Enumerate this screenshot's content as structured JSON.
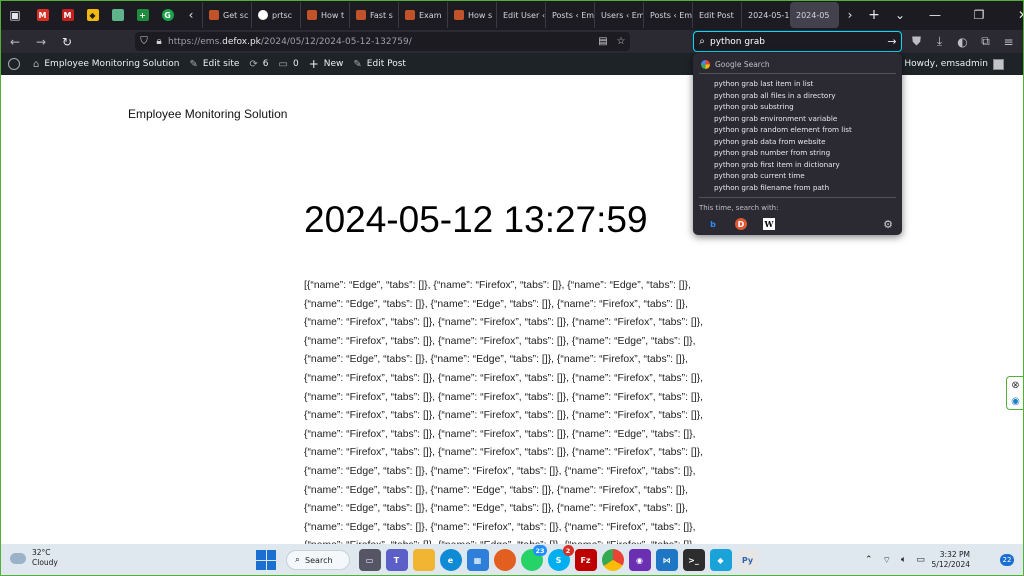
{
  "browser": {
    "tabs": [
      {
        "label": "Get sc",
        "favicon": "wp"
      },
      {
        "label": "prtsc",
        "favicon": "github"
      },
      {
        "label": "How t",
        "favicon": "wp"
      },
      {
        "label": "Fast s",
        "favicon": "wp"
      },
      {
        "label": "Exam",
        "favicon": "wp"
      },
      {
        "label": "How s",
        "favicon": "wp"
      },
      {
        "label": "Edit User ‹",
        "favicon": "none"
      },
      {
        "label": "Posts ‹ Em",
        "favicon": "none"
      },
      {
        "label": "Users ‹ Em",
        "favicon": "none"
      },
      {
        "label": "Posts ‹ Em",
        "favicon": "none"
      },
      {
        "label": "Edit Post",
        "favicon": "none"
      },
      {
        "label": "2024-05-1",
        "favicon": "none"
      },
      {
        "label": "2024-05",
        "favicon": "none",
        "active": true
      }
    ],
    "url_prefix": "https://ems.",
    "url_domain": "defox.pk",
    "url_path": "/2024/05/12/2024-05-12-132759/",
    "search_value": "python grab"
  },
  "search_dropdown": {
    "heading": "Google Search",
    "suggestions": [
      "python grab last item in list",
      "python grab all files in a directory",
      "python grab substring",
      "python grab environment variable",
      "python grab random element from list",
      "python grab data from website",
      "python grab number from string",
      "python grab first item in dictionary",
      "python grab current time",
      "python grab filename from path"
    ],
    "footer_label": "This time, search with:"
  },
  "adminbar": {
    "site_name": "Employee Monitoring Solution",
    "edit_site": "Edit site",
    "updates_count": "6",
    "comments_count": "0",
    "new_label": "New",
    "edit_post": "Edit Post",
    "howdy": "Howdy, emsadmin"
  },
  "page": {
    "site_title": "Employee Monitoring Solution",
    "post_title": "2024-05-12 13:27:59",
    "content": "[{“name”: “Edge”, “tabs”: []}, {“name”: “Firefox”, “tabs”: []}, {“name”: “Edge”, “tabs”: []}, {“name”: “Edge”, “tabs”: []}, {“name”: “Edge”, “tabs”: []}, {“name”: “Firefox”, “tabs”: []}, {“name”: “Firefox”, “tabs”: []}, {“name”: “Firefox”, “tabs”: []}, {“name”: “Firefox”, “tabs”: []}, {“name”: “Firefox”, “tabs”: []}, {“name”: “Firefox”, “tabs”: []}, {“name”: “Edge”, “tabs”: []}, {“name”: “Edge”, “tabs”: []}, {“name”: “Edge”, “tabs”: []}, {“name”: “Firefox”, “tabs”: []}, {“name”: “Firefox”, “tabs”: []}, {“name”: “Firefox”, “tabs”: []}, {“name”: “Firefox”, “tabs”: []}, {“name”: “Firefox”, “tabs”: []}, {“name”: “Firefox”, “tabs”: []}, {“name”: “Firefox”, “tabs”: []}, {“name”: “Firefox”, “tabs”: []}, {“name”: “Firefox”, “tabs”: []}, {“name”: “Firefox”, “tabs”: []}, {“name”: “Firefox”, “tabs”: []}, {“name”: “Firefox”, “tabs”: []}, {“name”: “Edge”, “tabs”: []}, {“name”: “Firefox”, “tabs”: []}, {“name”: “Firefox”, “tabs”: []}, {“name”: “Firefox”, “tabs”: []}, {“name”: “Edge”, “tabs”: []}, {“name”: “Firefox”, “tabs”: []}, {“name”: “Firefox”, “tabs”: []}, {“name”: “Edge”, “tabs”: []}, {“name”: “Edge”, “tabs”: []}, {“name”: “Firefox”, “tabs”: []}, {“name”: “Edge”, “tabs”: []}, {“name”: “Edge”, “tabs”: []}, {“name”: “Firefox”, “tabs”: []}, {“name”: “Edge”, “tabs”: []}, {“name”: “Firefox”, “tabs”: []}, {“name”: “Firefox”, “tabs”: []}, {“name”: “Firefox”, “tabs”: []}, {“name”: “Edge”, “tabs”: []}, {“name”: “Firefox”, “tabs”: []}"
  },
  "taskbar": {
    "temperature": "32°C",
    "weather": "Cloudy",
    "search_label": "Search",
    "whatsapp_badge": "23",
    "skype_badge": "2",
    "time": "3:32 PM",
    "date": "5/12/2024",
    "notifications": "22"
  }
}
